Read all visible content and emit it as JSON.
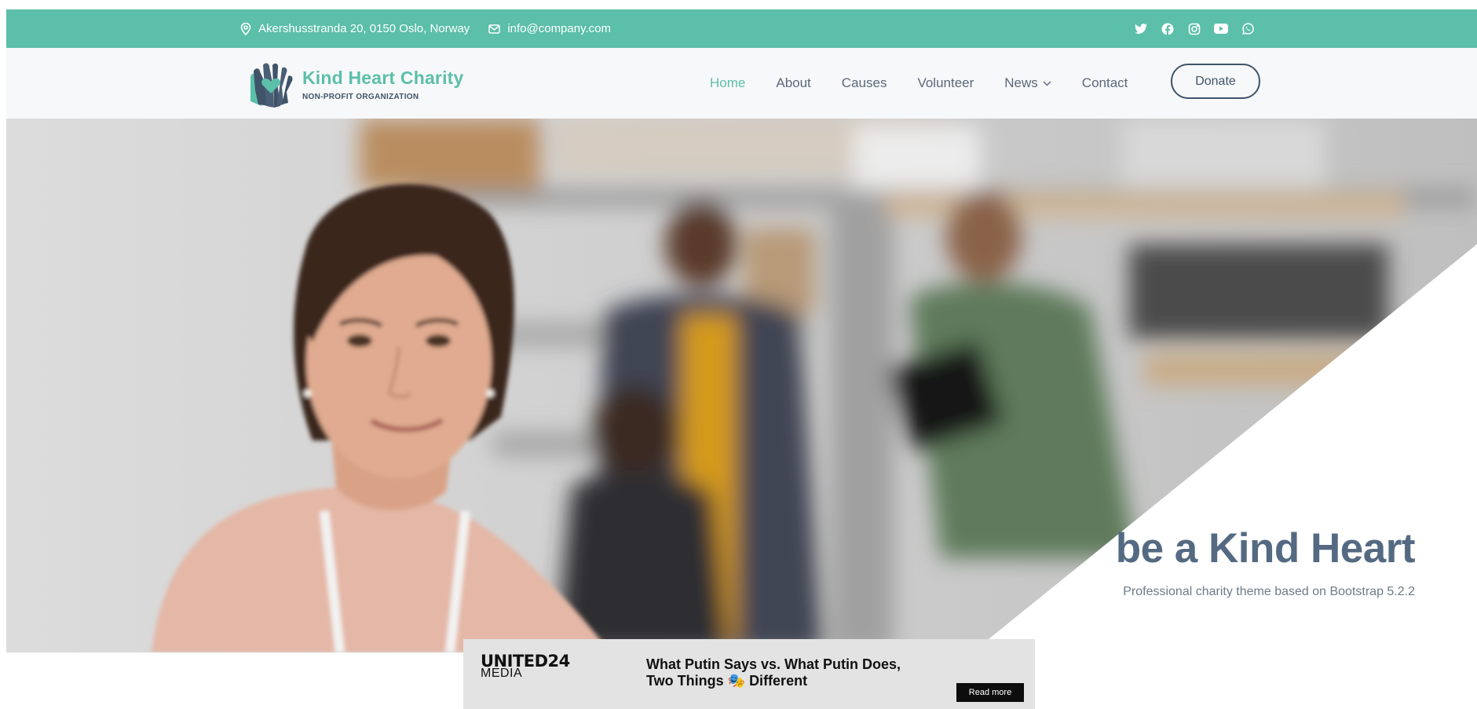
{
  "topbar": {
    "address": "Akershusstranda 20, 0150 Oslo, Norway",
    "email": "info@company.com",
    "social_icons": [
      "twitter-icon",
      "facebook-icon",
      "instagram-icon",
      "youtube-icon",
      "whatsapp-icon"
    ]
  },
  "brand": {
    "title": "Kind Heart Charity",
    "subtitle": "NON-PROFIT ORGANIZATION"
  },
  "nav": {
    "items": [
      "Home",
      "About",
      "Causes",
      "Volunteer",
      "News",
      "Contact"
    ],
    "active": "Home",
    "donate_label": "Donate"
  },
  "hero": {
    "headline": "be a Kind Heart",
    "tagline": "Professional charity theme based on Bootstrap 5.2.2"
  },
  "ad": {
    "brand_line1": "UNITED24",
    "brand_line2": "MEDIA",
    "headline": "What Putin Says vs. What Putin Does, Two Things 🎭 Different",
    "read_more": "Read more"
  },
  "colors": {
    "accent": "#5bbfa9",
    "dark": "#3f5468",
    "headline": "#546a82"
  }
}
